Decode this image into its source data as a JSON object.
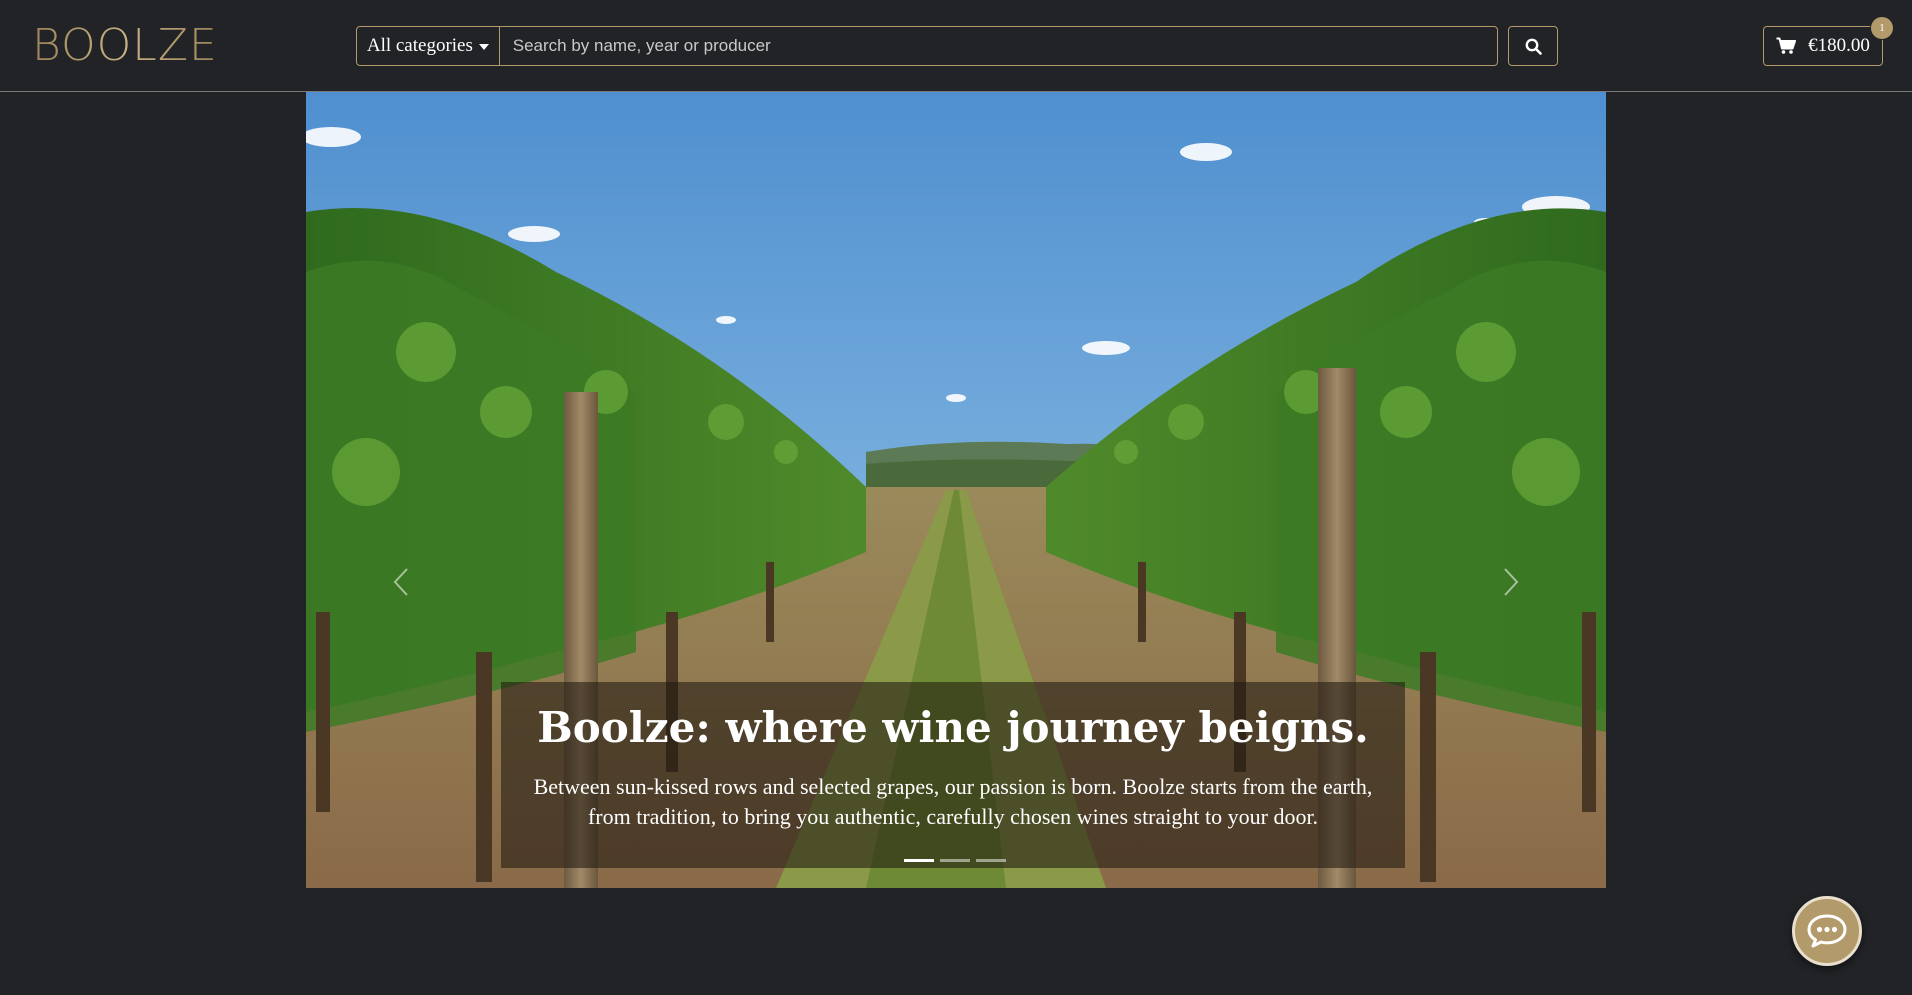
{
  "header": {
    "logo": "BOOLZE",
    "category_label": "All categories",
    "search_placeholder": "Search by name, year or producer",
    "search_icon": "search-icon",
    "cart_icon": "cart-icon",
    "cart_total": "€180.00",
    "cart_count": "1"
  },
  "hero": {
    "title": "Boolze: where wine journey beigns.",
    "text": "Between sun-kissed rows and selected grapes, our passion is born. Boolze starts from the earth, from tradition, to bring you authentic, carefully chosen wines straight to your door.",
    "active_slide": 1,
    "slide_count": 3,
    "prev_icon": "chevron-left-icon",
    "next_icon": "chevron-right-icon"
  },
  "chat": {
    "icon": "chat-bubble-icon"
  },
  "colors": {
    "background": "#212327",
    "accent": "#b39a6a",
    "text": "#ffffff"
  }
}
